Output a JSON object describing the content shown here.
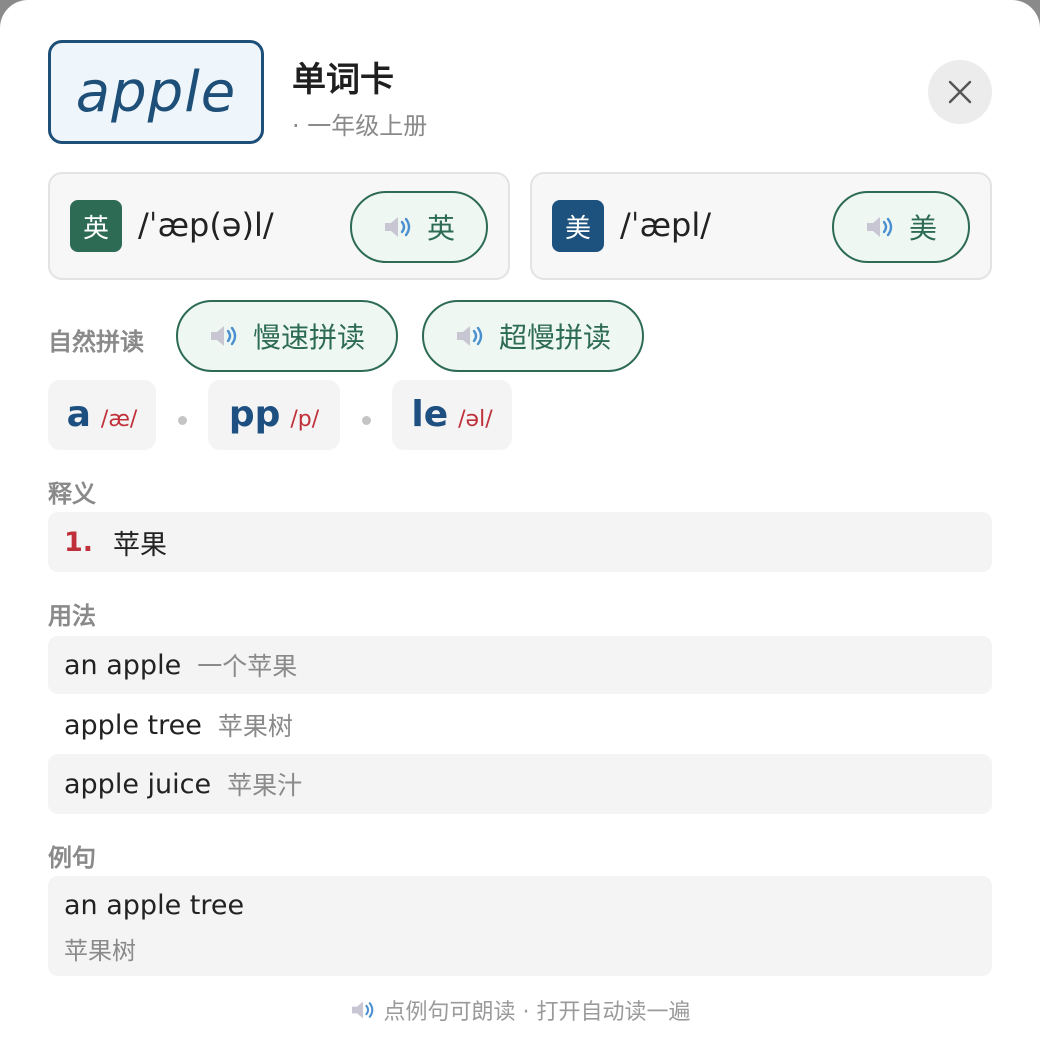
{
  "word": "apple",
  "header": {
    "title": "单词卡",
    "subtitle": "· 一年级上册"
  },
  "pronunciations": {
    "uk": {
      "badge": "英",
      "ipa": "/ˈæp(ə)l/",
      "button_label": "英"
    },
    "us": {
      "badge": "美",
      "ipa": "/ˈæpl/",
      "button_label": "美"
    }
  },
  "phonics": {
    "label": "自然拼读",
    "slow_button": "慢速拼读",
    "slower_button": "超慢拼读",
    "chunks": [
      {
        "letters": "a",
        "sound": "/æ/"
      },
      {
        "letters": "pp",
        "sound": "/p/"
      },
      {
        "letters": "le",
        "sound": "/əl/"
      }
    ]
  },
  "definitions": {
    "label": "释义",
    "items": [
      {
        "num": "1.",
        "text": "苹果"
      }
    ]
  },
  "usage": {
    "label": "用法",
    "items": [
      {
        "en": "an apple",
        "zh": "一个苹果"
      },
      {
        "en": "apple tree",
        "zh": "苹果树"
      },
      {
        "en": "apple juice",
        "zh": "苹果汁"
      }
    ]
  },
  "examples": {
    "label": "例句",
    "items": [
      {
        "en": "an apple tree",
        "zh": "苹果树"
      }
    ]
  },
  "footer": {
    "hint": "点例句可朗读 · 打开自动读一遍"
  },
  "icons": {
    "close": "close-icon",
    "speaker": "speaker-icon"
  },
  "colors": {
    "brand_blue": "#1e4f78",
    "uk_green": "#2d6b55",
    "us_blue": "#1d527e",
    "accent_red": "#c0303a"
  }
}
